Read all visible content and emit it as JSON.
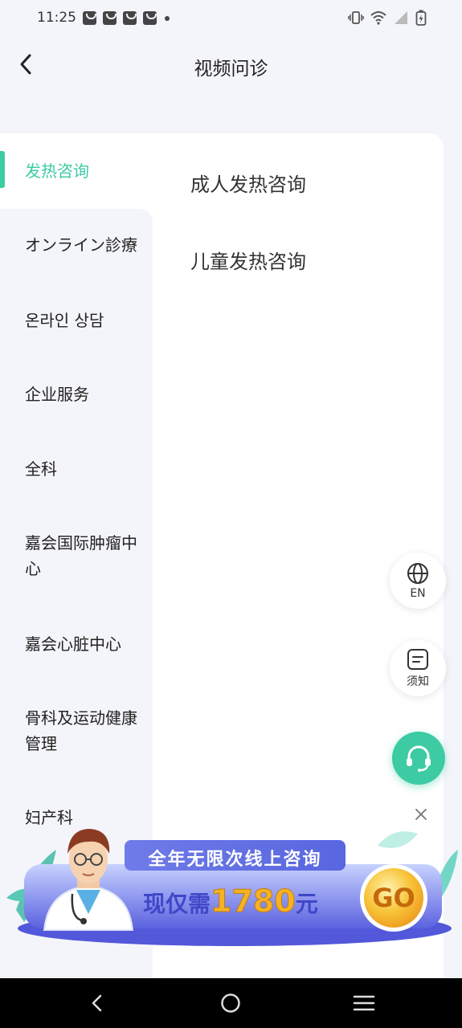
{
  "status_bar": {
    "time": "11:25",
    "notification_icons": [
      "shopping-bag-icon",
      "shopping-bag-icon",
      "shopping-bag-icon",
      "shopping-bag-icon",
      "dot-icon"
    ],
    "system_icons": [
      "vibrate-icon",
      "wifi-icon",
      "signal-icon",
      "battery-charging-icon"
    ]
  },
  "header": {
    "title": "视频问诊",
    "back_icon": "chevron-left-icon"
  },
  "sidebar": {
    "items": [
      {
        "label": "发热咨询",
        "active": true
      },
      {
        "label": "オンライン診療"
      },
      {
        "label": "온라인 상담"
      },
      {
        "label": "企业服务"
      },
      {
        "label": "全科"
      },
      {
        "label": "嘉会国际肿瘤中心"
      },
      {
        "label": "嘉会心脏中心"
      },
      {
        "label": "骨科及运动健康管理"
      },
      {
        "label": "妇产科"
      }
    ]
  },
  "sub_items": [
    {
      "label": "成人发热咨询"
    },
    {
      "label": "儿童发热咨询"
    }
  ],
  "floating": {
    "language": {
      "label": "EN",
      "icon": "globe-icon"
    },
    "notice": {
      "label": "须知",
      "icon": "notice-icon"
    },
    "support": {
      "icon": "headset-icon"
    }
  },
  "banner": {
    "line1": "全年无限次线上咨询",
    "line2_prefix": "现仅需",
    "price": "1780",
    "line2_suffix": "元",
    "cta": "GO",
    "close_icon": "close-icon"
  },
  "colors": {
    "accent": "#3ccba2",
    "banner_blue": "#5a63e0",
    "price_gold": "#f5b324"
  }
}
